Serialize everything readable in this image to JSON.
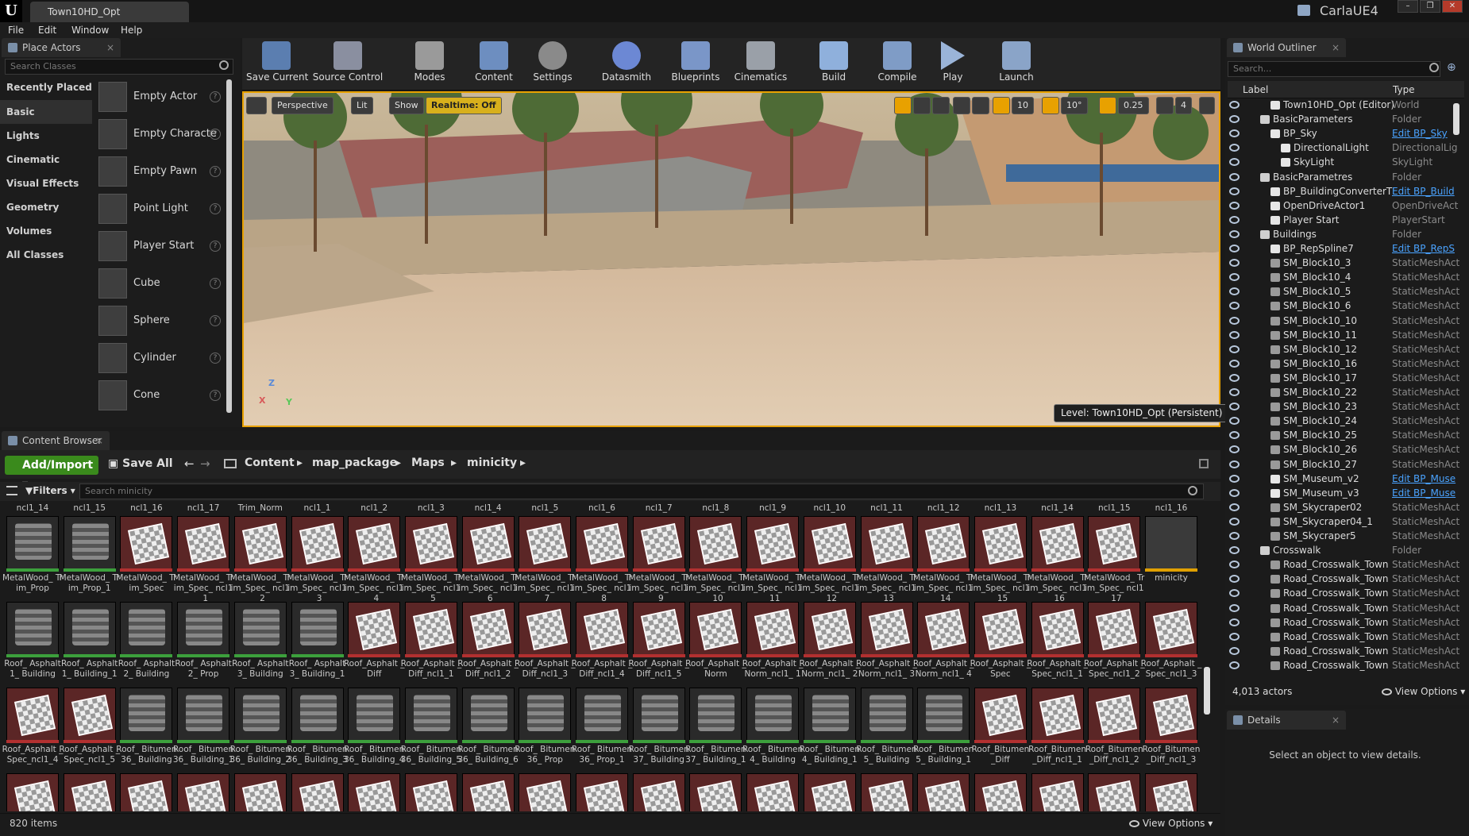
{
  "app": {
    "logo": "U",
    "document_tab": "Town10HD_Opt",
    "project": "CarlaUE4",
    "window_controls": [
      "–",
      "❐",
      "✕"
    ]
  },
  "menu": [
    "File",
    "Edit",
    "Window",
    "Help"
  ],
  "place_actors": {
    "tab": "Place Actors",
    "search_placeholder": "Search Classes",
    "categories": [
      "Recently Placed",
      "Basic",
      "Lights",
      "Cinematic",
      "Visual Effects",
      "Geometry",
      "Volumes",
      "All Classes"
    ],
    "actors": [
      "Empty Actor",
      "Empty Characte",
      "Empty Pawn",
      "Point Light",
      "Player Start",
      "Cube",
      "Sphere",
      "Cylinder",
      "Cone"
    ]
  },
  "toolbar": {
    "items": [
      "Save Current",
      "Source Control",
      "Modes",
      "Content",
      "Settings",
      "Datasmith",
      "Blueprints",
      "Cinematics",
      "Build",
      "Compile",
      "Play",
      "Launch"
    ]
  },
  "viewport": {
    "perspective": "Perspective",
    "lit": "Lit",
    "show": "Show",
    "realtime": "Realtime: Off",
    "grid_snap": "10",
    "rot_snap": "10°",
    "scale_snap": "0.25",
    "cam_speed": "4",
    "level": "Level:  Town10HD_Opt (Persistent)",
    "axis_z": "Z",
    "axis_x": "X",
    "axis_y": "Y"
  },
  "outliner": {
    "tab": "World Outliner",
    "search_placeholder": "Search...",
    "col_label": "Label",
    "col_type": "Type",
    "rows": [
      {
        "label": "Town10HD_Opt (Editor)",
        "type": "World"
      },
      {
        "label": "BasicParameters",
        "type": "Folder"
      },
      {
        "label": "BP_Sky",
        "type": "Edit BP_Sky"
      },
      {
        "label": "DirectionalLight",
        "type": "DirectionalLig"
      },
      {
        "label": "SkyLight",
        "type": "SkyLight"
      },
      {
        "label": "BasicParametres",
        "type": "Folder"
      },
      {
        "label": "BP_BuildingConverterT",
        "type": "Edit BP_Build"
      },
      {
        "label": "OpenDriveActor1",
        "type": "OpenDriveAct"
      },
      {
        "label": "Player Start",
        "type": "PlayerStart"
      },
      {
        "label": "Buildings",
        "type": "Folder"
      },
      {
        "label": "BP_RepSpline7",
        "type": "Edit BP_RepS"
      },
      {
        "label": "SM_Block10_3",
        "type": "StaticMeshAct"
      },
      {
        "label": "SM_Block10_4",
        "type": "StaticMeshAct"
      },
      {
        "label": "SM_Block10_5",
        "type": "StaticMeshAct"
      },
      {
        "label": "SM_Block10_6",
        "type": "StaticMeshAct"
      },
      {
        "label": "SM_Block10_10",
        "type": "StaticMeshAct"
      },
      {
        "label": "SM_Block10_11",
        "type": "StaticMeshAct"
      },
      {
        "label": "SM_Block10_12",
        "type": "StaticMeshAct"
      },
      {
        "label": "SM_Block10_16",
        "type": "StaticMeshAct"
      },
      {
        "label": "SM_Block10_17",
        "type": "StaticMeshAct"
      },
      {
        "label": "SM_Block10_22",
        "type": "StaticMeshAct"
      },
      {
        "label": "SM_Block10_23",
        "type": "StaticMeshAct"
      },
      {
        "label": "SM_Block10_24",
        "type": "StaticMeshAct"
      },
      {
        "label": "SM_Block10_25",
        "type": "StaticMeshAct"
      },
      {
        "label": "SM_Block10_26",
        "type": "StaticMeshAct"
      },
      {
        "label": "SM_Block10_27",
        "type": "StaticMeshAct"
      },
      {
        "label": "SM_Museum_v2",
        "type": "Edit BP_Muse"
      },
      {
        "label": "SM_Museum_v3",
        "type": "Edit BP_Muse"
      },
      {
        "label": "SM_Skycraper02",
        "type": "StaticMeshAct"
      },
      {
        "label": "SM_Skycraper04_1",
        "type": "StaticMeshAct"
      },
      {
        "label": "SM_Skycraper5",
        "type": "StaticMeshAct"
      },
      {
        "label": "Crosswalk",
        "type": "Folder"
      },
      {
        "label": "Road_Crosswalk_Town",
        "type": "StaticMeshAct"
      },
      {
        "label": "Road_Crosswalk_Town",
        "type": "StaticMeshAct"
      },
      {
        "label": "Road_Crosswalk_Town",
        "type": "StaticMeshAct"
      },
      {
        "label": "Road_Crosswalk_Town",
        "type": "StaticMeshAct"
      },
      {
        "label": "Road_Crosswalk_Town",
        "type": "StaticMeshAct"
      },
      {
        "label": "Road_Crosswalk_Town",
        "type": "StaticMeshAct"
      },
      {
        "label": "Road_Crosswalk_Town",
        "type": "StaticMeshAct"
      },
      {
        "label": "Road_Crosswalk_Town",
        "type": "StaticMeshAct"
      }
    ],
    "count": "4,013 actors",
    "view_options": "View Options"
  },
  "details": {
    "tab": "Details",
    "empty": "Select an object to view details."
  },
  "content_browser": {
    "tab": "Content Browser",
    "add_import": "Add/Import",
    "save_all": "Save All",
    "path": [
      "Content",
      "map_package",
      "Maps",
      "minicity"
    ],
    "filters": "Filters",
    "search_placeholder": "Search minicity",
    "top_row": [
      "ncl1_14",
      "ncl1_15",
      "ncl1_16",
      "ncl1_17",
      "Trim_Norm",
      "ncl1_1",
      "ncl1_2",
      "ncl1_3",
      "ncl1_4",
      "ncl1_5",
      "ncl1_6",
      "ncl1_7",
      "ncl1_8",
      "ncl1_9",
      "ncl1_10",
      "ncl1_11",
      "ncl1_12",
      "ncl1_13",
      "ncl1_14",
      "ncl1_15",
      "ncl1_16"
    ],
    "rows": [
      [
        [
          "MetalWood_ Trim_Prop",
          "tex"
        ],
        [
          "MetalWood_ Trim_Prop_1",
          "tex"
        ],
        [
          "MetalWood_ Trim_Spec",
          "mat"
        ],
        [
          "MetalWood_ Trim_Spec_ ncl1_1",
          "mat"
        ],
        [
          "MetalWood_ Trim_Spec_ ncl1_2",
          "mat"
        ],
        [
          "MetalWood_ Trim_Spec_ ncl1_3",
          "mat"
        ],
        [
          "MetalWood_ Trim_Spec_ ncl1_4",
          "mat"
        ],
        [
          "MetalWood_ Trim_Spec_ ncl1_5",
          "mat"
        ],
        [
          "MetalWood_ Trim_Spec_ ncl1_6",
          "mat"
        ],
        [
          "MetalWood_ Trim_Spec_ ncl1_7",
          "mat"
        ],
        [
          "MetalWood_ Trim_Spec_ ncl1_8",
          "mat"
        ],
        [
          "MetalWood_ Trim_Spec_ ncl1_9",
          "mat"
        ],
        [
          "MetalWood_ Trim_Spec_ ncl1_10",
          "mat"
        ],
        [
          "MetalWood_ Trim_Spec_ ncl1_11",
          "mat"
        ],
        [
          "MetalWood_ Trim_Spec_ ncl1_12",
          "mat"
        ],
        [
          "MetalWood_ Trim_Spec_ ncl1_13",
          "mat"
        ],
        [
          "MetalWood_ Trim_Spec_ ncl1_14",
          "mat"
        ],
        [
          "MetalWood_ Trim_Spec_ ncl1_15",
          "mat"
        ],
        [
          "MetalWood_ Trim_Spec_ ncl1_16",
          "mat"
        ],
        [
          "MetalWood_ Trim_Spec_ ncl1_17",
          "mat"
        ],
        [
          "minicity",
          "map"
        ]
      ],
      [
        [
          "Roof_ Asphalt1_ Building",
          "tex"
        ],
        [
          "Roof_ Asphalt1_ Building_1",
          "tex"
        ],
        [
          "Roof_ Asphalt2_ Building",
          "tex"
        ],
        [
          "Roof_ Asphalt2_ Prop",
          "tex"
        ],
        [
          "Roof_ Asphalt3_ Building",
          "tex"
        ],
        [
          "Roof_ Asphalt3_ Building_1",
          "tex"
        ],
        [
          "Roof_Asphalt _Diff",
          "mat"
        ],
        [
          "Roof_Asphalt _Diff_ncl1_1",
          "mat"
        ],
        [
          "Roof_Asphalt _Diff_ncl1_2",
          "mat"
        ],
        [
          "Roof_Asphalt _Diff_ncl1_3",
          "mat"
        ],
        [
          "Roof_Asphalt _Diff_ncl1_4",
          "mat"
        ],
        [
          "Roof_Asphalt _Diff_ncl1_5",
          "mat"
        ],
        [
          "Roof_Asphalt _Norm",
          "mat"
        ],
        [
          "Roof_Asphalt _Norm_ncl1_ 1",
          "mat"
        ],
        [
          "Roof_Asphalt _Norm_ncl1_ 2",
          "mat"
        ],
        [
          "Roof_Asphalt _Norm_ncl1_ 3",
          "mat"
        ],
        [
          "Roof_Asphalt _Norm_ncl1_ 4",
          "mat"
        ],
        [
          "Roof_Asphalt _Spec",
          "mat"
        ],
        [
          "Roof_Asphalt _Spec_ncl1_1",
          "mat"
        ],
        [
          "Roof_Asphalt _Spec_ncl1_2",
          "mat"
        ],
        [
          "Roof_Asphalt _Spec_ncl1_3",
          "mat"
        ]
      ],
      [
        [
          "Roof_Asphalt _Spec_ncl1_4",
          "mat"
        ],
        [
          "Roof_Asphalt _Spec_ncl1_5",
          "mat"
        ],
        [
          "Roof_ Bitumen36_ Building",
          "tex"
        ],
        [
          "Roof_ Bitumen36_ Building_1",
          "tex"
        ],
        [
          "Roof_ Bitumen36_ Building_2",
          "tex"
        ],
        [
          "Roof_ Bitumen36_ Building_3",
          "tex"
        ],
        [
          "Roof_ Bitumen36_ Building_4",
          "tex"
        ],
        [
          "Roof_ Bitumen36_ Building_5",
          "tex"
        ],
        [
          "Roof_ Bitumen36_ Building_6",
          "tex"
        ],
        [
          "Roof_ Bitumen36_ Prop",
          "tex"
        ],
        [
          "Roof_ Bitumen36_ Prop_1",
          "tex"
        ],
        [
          "Roof_ Bitumen37_ Building",
          "tex"
        ],
        [
          "Roof_ Bitumen37_ Building_1",
          "tex"
        ],
        [
          "Roof_ Bitumen4_ Building",
          "tex"
        ],
        [
          "Roof_ Bitumen4_ Building_1",
          "tex"
        ],
        [
          "Roof_ Bitumen5_ Building",
          "tex"
        ],
        [
          "Roof_ Bitumen5_ Building_1",
          "tex"
        ],
        [
          "Roof_Bitumen _Diff",
          "mat"
        ],
        [
          "Roof_Bitumen _Diff_ncl1_1",
          "mat"
        ],
        [
          "Roof_Bitumen _Diff_ncl1_2",
          "mat"
        ],
        [
          "Roof_Bitumen _Diff_ncl1_3",
          "mat"
        ]
      ]
    ],
    "item_count": "820 items",
    "view_options": "View Options"
  }
}
